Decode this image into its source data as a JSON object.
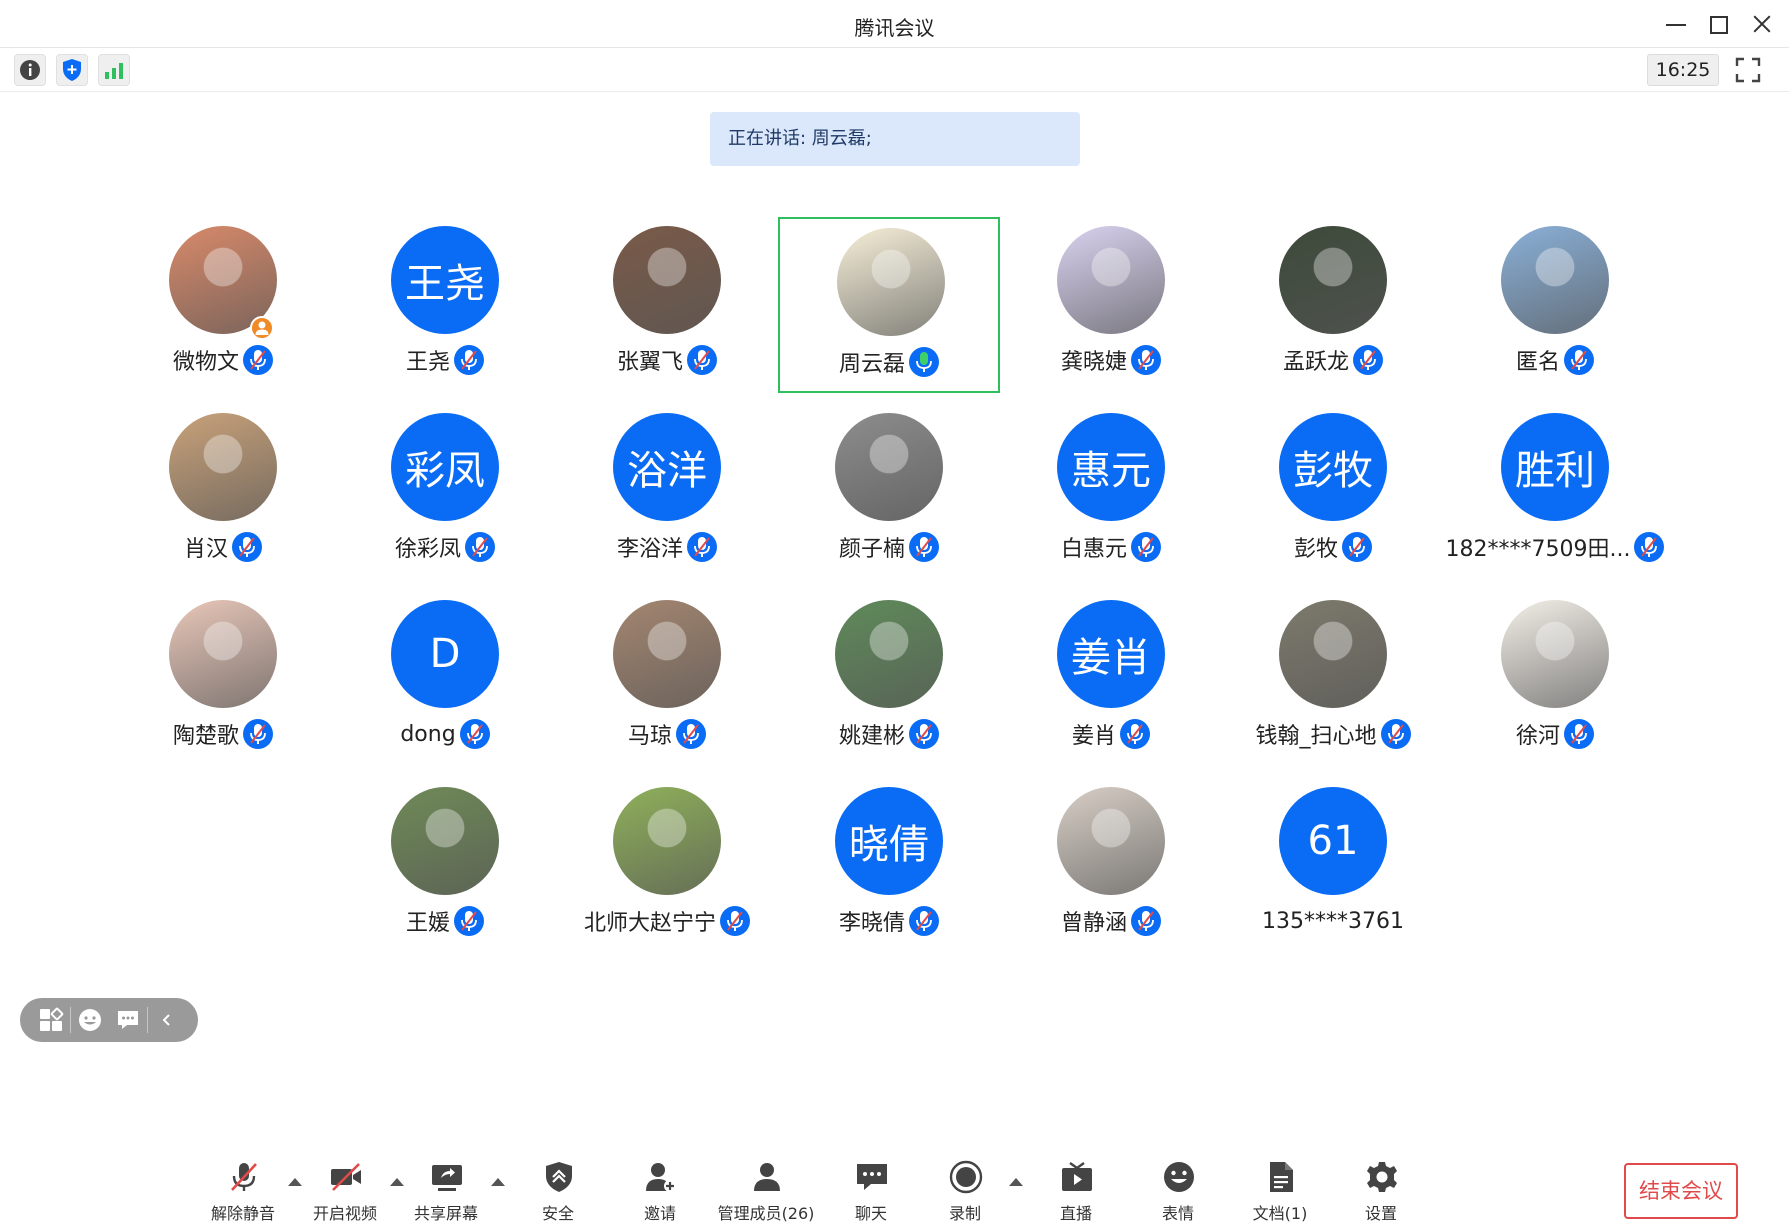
{
  "window": {
    "title": "腾讯会议"
  },
  "topbar": {
    "time": "16:25"
  },
  "speaking": {
    "text": "正在讲话: 周云磊;"
  },
  "colors": {
    "accent": "#0a6cf5",
    "active_border": "#2fbf5e",
    "end_button": "#e04a4a"
  },
  "participants": [
    {
      "name": "微物文",
      "avatar": "photo",
      "initials": "",
      "tone": "#d98a6a",
      "mic": "muted",
      "host": true
    },
    {
      "name": "王尧",
      "avatar": "blue",
      "initials": "王尧",
      "mic": "muted"
    },
    {
      "name": "张翼飞",
      "avatar": "photo",
      "initials": "",
      "tone": "#7a5a48",
      "mic": "muted"
    },
    {
      "name": "周云磊",
      "avatar": "photo",
      "initials": "",
      "tone": "#f6efd8",
      "mic": "speaking",
      "active": true
    },
    {
      "name": "龚晓婕",
      "avatar": "photo",
      "initials": "",
      "tone": "#d9d2f0",
      "mic": "muted"
    },
    {
      "name": "孟跃龙",
      "avatar": "photo",
      "initials": "",
      "tone": "#3d4a3a",
      "mic": "muted"
    },
    {
      "name": "匿名",
      "avatar": "photo",
      "initials": "",
      "tone": "#8ab0d8",
      "mic": "muted"
    },
    {
      "name": "肖汉",
      "avatar": "photo",
      "initials": "",
      "tone": "#c9a27a",
      "mic": "muted"
    },
    {
      "name": "徐彩凤",
      "avatar": "blue",
      "initials": "彩凤",
      "mic": "muted"
    },
    {
      "name": "李浴洋",
      "avatar": "blue",
      "initials": "浴洋",
      "mic": "muted"
    },
    {
      "name": "颜子楠",
      "avatar": "photo",
      "initials": "",
      "tone": "#8d8d8d",
      "mic": "muted"
    },
    {
      "name": "白惠元",
      "avatar": "blue",
      "initials": "惠元",
      "mic": "muted"
    },
    {
      "name": "彭牧",
      "avatar": "blue",
      "initials": "彭牧",
      "mic": "muted"
    },
    {
      "name": "182****7509田...",
      "avatar": "blue",
      "initials": "胜利",
      "mic": "muted"
    },
    {
      "name": "陶楚歌",
      "avatar": "photo",
      "initials": "",
      "tone": "#e9c7b9",
      "mic": "muted"
    },
    {
      "name": "dong",
      "avatar": "blue",
      "initials": "D",
      "mic": "muted"
    },
    {
      "name": "马琼",
      "avatar": "photo",
      "initials": "",
      "tone": "#a48670",
      "mic": "muted"
    },
    {
      "name": "姚建彬",
      "avatar": "photo",
      "initials": "",
      "tone": "#5f8a5a",
      "mic": "muted"
    },
    {
      "name": "姜肖",
      "avatar": "blue",
      "initials": "姜肖",
      "mic": "muted"
    },
    {
      "name": "钱翰_扫心地",
      "avatar": "photo",
      "initials": "",
      "tone": "#7d7a6c",
      "mic": "muted"
    },
    {
      "name": "徐河",
      "avatar": "photo",
      "initials": "",
      "tone": "#f3efe8",
      "mic": "muted"
    },
    {
      "name": "王媛",
      "avatar": "photo",
      "initials": "",
      "tone": "#6f8a57",
      "mic": "muted"
    },
    {
      "name": "北师大赵宁宁",
      "avatar": "photo",
      "initials": "",
      "tone": "#8fb05a",
      "mic": "muted"
    },
    {
      "name": "李晓倩",
      "avatar": "blue",
      "initials": "晓倩",
      "mic": "muted"
    },
    {
      "name": "曾静涵",
      "avatar": "photo",
      "initials": "",
      "tone": "#d8cfc6",
      "mic": "muted"
    },
    {
      "name": "135****3761",
      "avatar": "blue",
      "initials": "61",
      "mic": "none"
    }
  ],
  "toolbar": {
    "unmute": "解除静音",
    "video": "开启视频",
    "share": "共享屏幕",
    "security": "安全",
    "invite": "邀请",
    "members": "管理成员(26)",
    "chat": "聊天",
    "record": "录制",
    "live": "直播",
    "emoji": "表情",
    "docs": "文档(1)",
    "settings": "设置",
    "end": "结束会议"
  },
  "icons": {
    "info": "info-icon",
    "shield": "shield-icon",
    "signal": "signal-icon",
    "fullscreen": "fullscreen-icon",
    "layout": "layout-icon",
    "face": "emoji-icon",
    "bubble": "chat-icon",
    "collapse": "chevron-left-icon"
  }
}
